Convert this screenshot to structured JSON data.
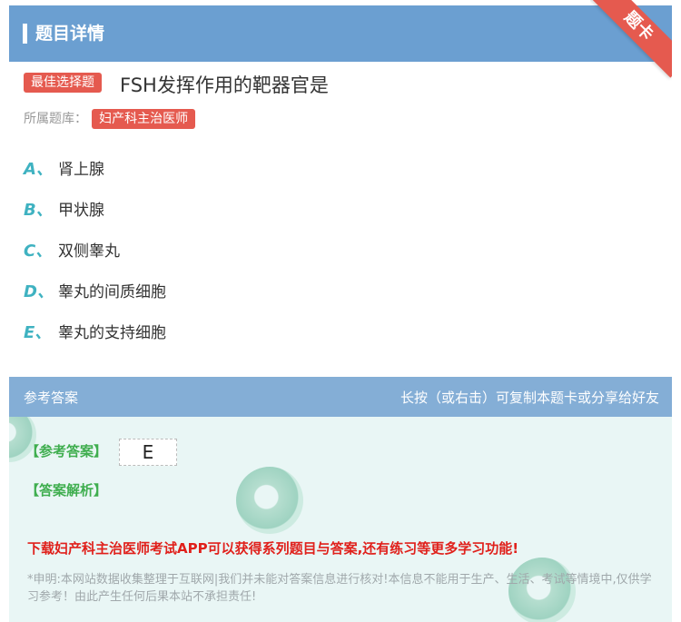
{
  "header": {
    "title": "题目详情"
  },
  "ribbon": {
    "label": "题卡"
  },
  "question": {
    "type_tag": "最佳选择题",
    "text": "FSH发挥作用的靶器官是",
    "bank_label": "所属题库：",
    "bank_name": "妇产科主治医师"
  },
  "options": [
    {
      "letter": "A、",
      "text": "肾上腺"
    },
    {
      "letter": "B、",
      "text": "甲状腺"
    },
    {
      "letter": "C、",
      "text": "双侧睾丸"
    },
    {
      "letter": "D、",
      "text": "睾丸的间质细胞"
    },
    {
      "letter": "E、",
      "text": "睾丸的支持细胞"
    }
  ],
  "answer_section": {
    "title": "参考答案",
    "copy_hint": "长按（或右击）可复制本题卡或分享给好友",
    "answer_label": "【参考答案】",
    "answer_value": "E",
    "explanation_label": "【答案解析】",
    "promo": "下载妇产科主治医师考试APP可以获得系列题目与答案,还有练习等更多学习功能!",
    "disclaimer": "*申明:本网站数据收集整理于互联网|我们并未能对答案信息进行核对!本信息不能用于生产、生活、考试等情境中,仅供学习参考！由此产生任何后果本站不承担责任!"
  },
  "colors": {
    "header_bg": "#6b9fd1",
    "accent_red": "#e55a4f",
    "option_letter": "#3fb2c1",
    "answer_head_bg": "#84aed6",
    "answer_body_bg": "#e9f6f5",
    "answer_label": "#3fae4f",
    "promo_text": "#e0201b"
  }
}
